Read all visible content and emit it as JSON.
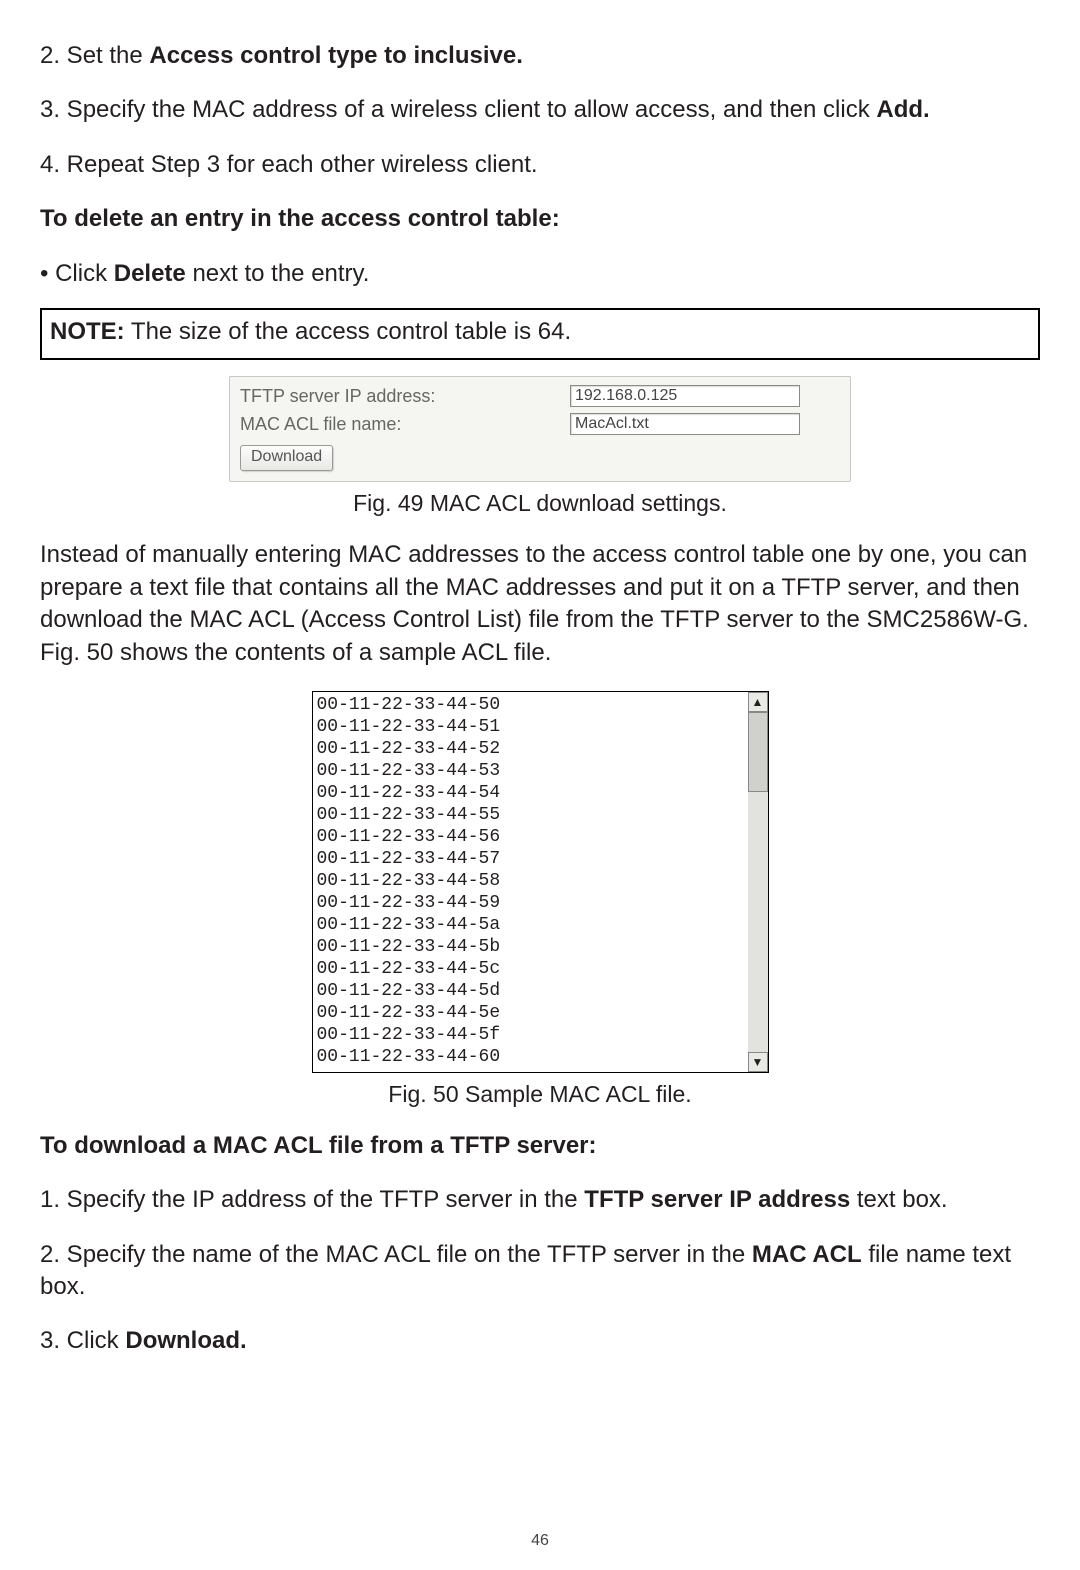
{
  "step2": {
    "prefix": "2. Set the ",
    "bold": "Access control type to inclusive.",
    "suffix": ""
  },
  "step3": {
    "prefix": "3. Specify the MAC address of a wireless client to allow access, and then click ",
    "bold": "Add.",
    "suffix": ""
  },
  "step4": "4. Repeat Step 3 for each other wireless client.",
  "delete_heading": "To delete an entry in the access control table:",
  "bullet_delete": {
    "prefix": "•   Click ",
    "bold": "Delete",
    "suffix": " next to the entry."
  },
  "note": {
    "label": "NOTE:",
    "text": " The size of the access control table is 64."
  },
  "fig49": {
    "tftp_label": "TFTP server IP address:",
    "tftp_value": "192.168.0.125",
    "mac_label": "MAC ACL file name:",
    "mac_value": "MacAcl.txt",
    "download_btn": "Download",
    "caption": "Fig. 49 MAC ACL download settings."
  },
  "para_instead": "Instead of manually entering MAC addresses to the access control table one by one, you can prepare a text file that contains all the MAC addresses and put it on a TFTP server, and then download the MAC ACL (Access Control List) file from the TFTP server to the SMC2586W-G. Fig. 50 shows the contents of a sample ACL file.",
  "fig50": {
    "lines": [
      "00-11-22-33-44-50",
      "00-11-22-33-44-51",
      "00-11-22-33-44-52",
      "00-11-22-33-44-53",
      "00-11-22-33-44-54",
      "00-11-22-33-44-55",
      "00-11-22-33-44-56",
      "00-11-22-33-44-57",
      "00-11-22-33-44-58",
      "00-11-22-33-44-59",
      "00-11-22-33-44-5a",
      "00-11-22-33-44-5b",
      "00-11-22-33-44-5c",
      "00-11-22-33-44-5d",
      "00-11-22-33-44-5e",
      "00-11-22-33-44-5f",
      "00-11-22-33-44-60"
    ],
    "caption": "Fig. 50 Sample MAC ACL file."
  },
  "download_heading": "To download a MAC ACL file from a TFTP server:",
  "dl_step1": {
    "prefix": "1. Specify the IP address of the TFTP server in the ",
    "bold": "TFTP server IP address",
    "suffix": " text box."
  },
  "dl_step2": {
    "prefix": "2. Specify the name of the MAC ACL file on the TFTP server in the ",
    "bold": "MAC ACL",
    "suffix": " file name text box."
  },
  "dl_step3": {
    "prefix": "3. Click ",
    "bold": "Download.",
    "suffix": ""
  },
  "page_number": "46"
}
